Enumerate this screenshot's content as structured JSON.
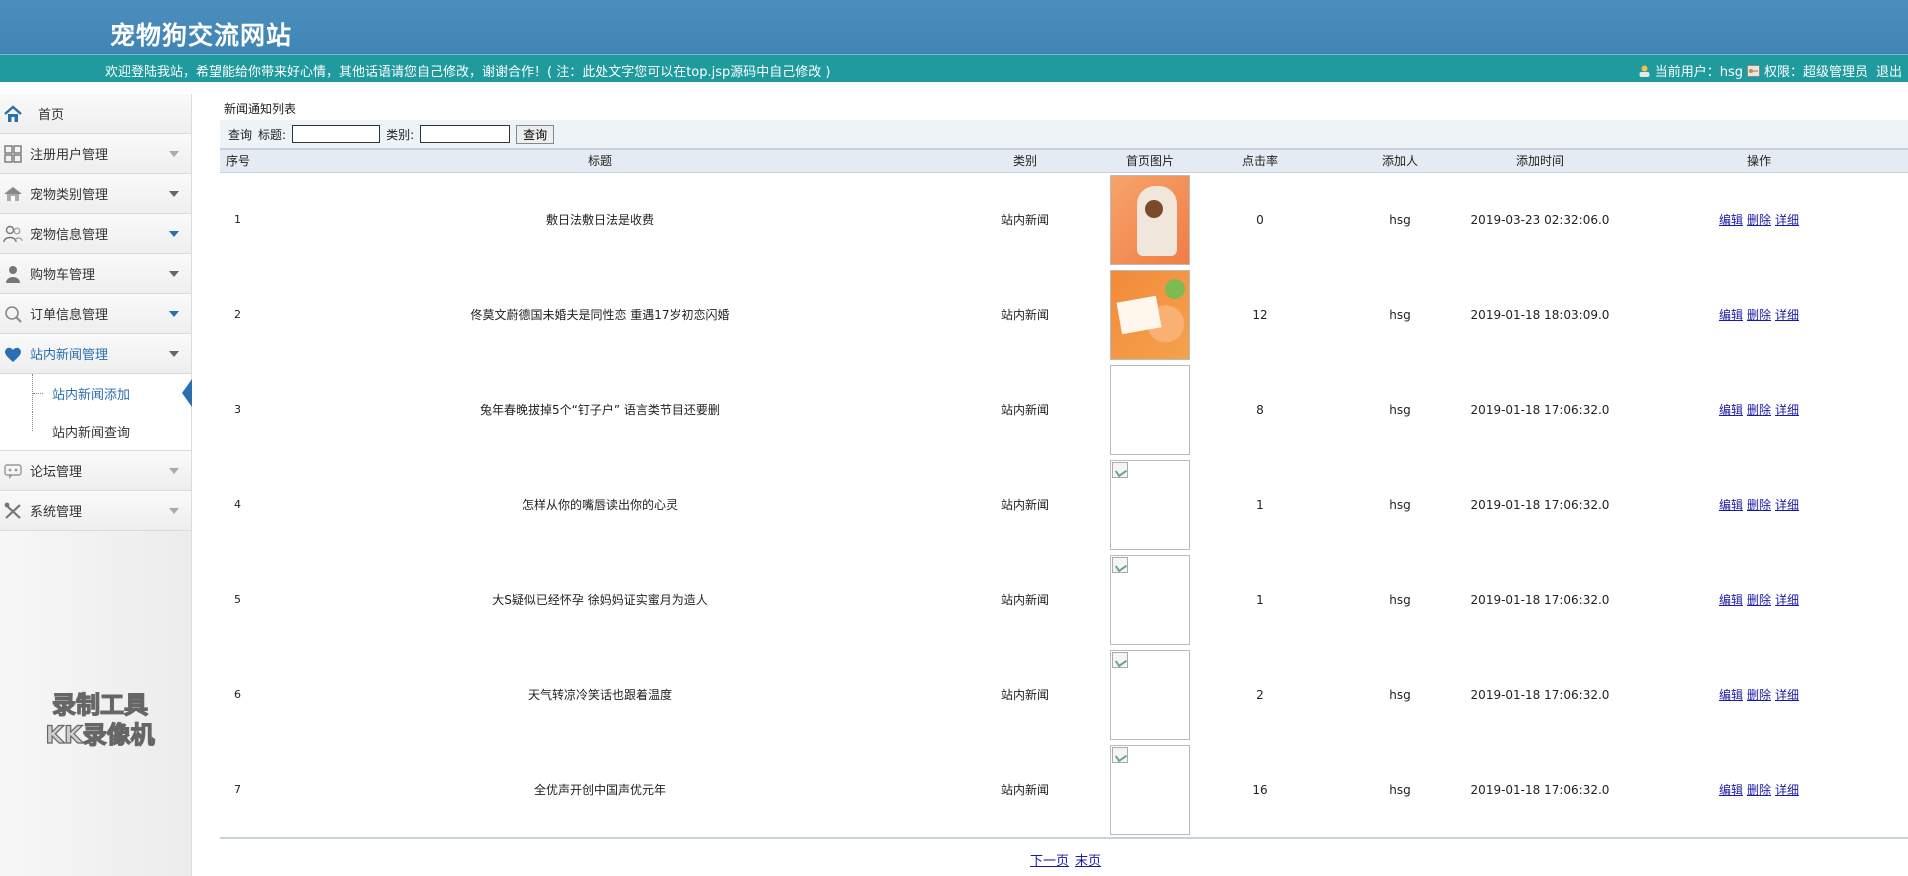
{
  "header": {
    "site_title": "宠物狗交流网站",
    "welcome": "欢迎登陆我站，希望能给你带来好心情，其他话语请您自己修改，谢谢合作！( 注：此处文字您可以在top.jsp源码中自己修改 )",
    "current_user_label": "当前用户：hsg",
    "role_label": "权限：超级管理员",
    "logout_label": "退出"
  },
  "sidebar": {
    "home": "首页",
    "items": [
      {
        "label": "注册用户管理",
        "icon": "users-grid-icon"
      },
      {
        "label": "宠物类别管理",
        "icon": "house-icon"
      },
      {
        "label": "宠物信息管理",
        "icon": "people-icon"
      },
      {
        "label": "购物车管理",
        "icon": "person-icon"
      },
      {
        "label": "订单信息管理",
        "icon": "search-icon"
      },
      {
        "label": "站内新闻管理",
        "icon": "heart-icon"
      }
    ],
    "sub_items": [
      "站内新闻添加",
      "站内新闻查询"
    ],
    "items_after": [
      {
        "label": "论坛管理",
        "icon": "forum-icon"
      },
      {
        "label": "系统管理",
        "icon": "tools-icon"
      }
    ],
    "watermark_line1": "录制工具",
    "watermark_line2": "KK录像机"
  },
  "main": {
    "caption": "新闻通知列表",
    "search": {
      "label": "查询",
      "title_label": "标题:",
      "category_label": "类别:",
      "title_value": "",
      "category_value": "",
      "button": "查询"
    },
    "columns": [
      "序号",
      "标题",
      "类别",
      "首页图片",
      "点击率",
      "添加人",
      "添加时间",
      "操作"
    ],
    "rows": [
      {
        "seq": "1",
        "title": "敷日法敷日法是收费",
        "category": "站内新闻",
        "image": "dog-photo",
        "clicks": "0",
        "author": "hsg",
        "time": "2019-03-23 02:32:06.0"
      },
      {
        "seq": "2",
        "title": "佟莫文蔚德国未婚夫是同性恋 重遇17岁初恋闪婚",
        "category": "站内新闻",
        "image": "food-photo",
        "clicks": "12",
        "author": "hsg",
        "time": "2019-01-18 18:03:09.0"
      },
      {
        "seq": "3",
        "title": "兔年春晚拔掉5个“钉子户” 语言类节目还要删",
        "category": "站内新闻",
        "image": "blank",
        "clicks": "8",
        "author": "hsg",
        "time": "2019-01-18 17:06:32.0"
      },
      {
        "seq": "4",
        "title": "怎样从你的嘴唇读出你的心灵",
        "category": "站内新闻",
        "image": "broken",
        "clicks": "1",
        "author": "hsg",
        "time": "2019-01-18 17:06:32.0"
      },
      {
        "seq": "5",
        "title": "大S疑似已经怀孕 徐妈妈证实蜜月为造人",
        "category": "站内新闻",
        "image": "broken",
        "clicks": "1",
        "author": "hsg",
        "time": "2019-01-18 17:06:32.0"
      },
      {
        "seq": "6",
        "title": "天气转凉冷笑话也跟着温度",
        "category": "站内新闻",
        "image": "broken",
        "clicks": "2",
        "author": "hsg",
        "time": "2019-01-18 17:06:32.0"
      },
      {
        "seq": "7",
        "title": "全优声开创中国声优元年",
        "category": "站内新闻",
        "image": "broken",
        "clicks": "16",
        "author": "hsg",
        "time": "2019-01-18 17:06:32.0"
      }
    ],
    "ops": {
      "edit": "编辑",
      "delete": "删除",
      "detail": "详细"
    },
    "pager": {
      "next": "下一页",
      "last": "末页"
    }
  },
  "colors": {
    "header": "#3b7fae",
    "bar": "#1f9a9d",
    "link": "#1a1aa6",
    "active": "#2a6fb0"
  }
}
